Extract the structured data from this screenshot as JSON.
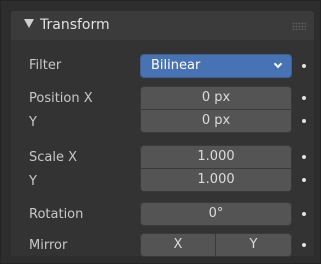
{
  "panel": {
    "title": "Transform",
    "filter": {
      "label": "Filter",
      "value": "Bilinear"
    },
    "position_x": {
      "label": "Position X",
      "value": "0 px"
    },
    "position_y": {
      "label": "Y",
      "value": "0 px"
    },
    "scale_x": {
      "label": "Scale X",
      "value": "1.000"
    },
    "scale_y": {
      "label": "Y",
      "value": "1.000"
    },
    "rotation": {
      "label": "Rotation",
      "value": "0°"
    },
    "mirror": {
      "label": "Mirror",
      "x_label": "X",
      "y_label": "Y"
    }
  },
  "colors": {
    "accent": "#4772b3",
    "panel_bg": "#333333",
    "field_bg": "#545454"
  }
}
